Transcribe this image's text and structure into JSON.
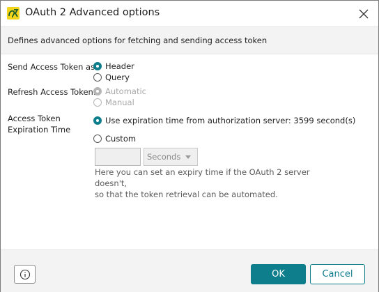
{
  "window": {
    "title": "OAuth 2 Advanced options",
    "icon": "app-logo-icon",
    "close_icon": "close-icon"
  },
  "description": "Defines advanced options for fetching and sending access token",
  "send_token": {
    "label": "Send Access Token as:",
    "options": [
      {
        "label": "Header",
        "checked": true
      },
      {
        "label": "Query",
        "checked": false
      }
    ]
  },
  "refresh_token": {
    "label": "Refresh Access Token:",
    "options": [
      {
        "label": "Automatic",
        "checked": true,
        "disabled": true
      },
      {
        "label": "Manual",
        "checked": false,
        "disabled": true
      }
    ]
  },
  "expiration": {
    "label_line1": "Access Token",
    "label_line2": "Expiration Time",
    "options": [
      {
        "label": "Use expiration time from authorization server: 3599 second(s)",
        "checked": true
      },
      {
        "label": "Custom",
        "checked": false
      }
    ],
    "custom_value": "",
    "unit": "Seconds",
    "hint_line1": "Here you can set an expiry time if the OAuth 2 server doesn't,",
    "hint_line2": "so that the token retrieval can be automated."
  },
  "footer": {
    "info_icon": "info-icon",
    "ok_label": "OK",
    "cancel_label": "Cancel"
  },
  "colors": {
    "accent": "#0e7d8c",
    "band": "#f3f3f3",
    "icon_bg": "#f2d51c"
  }
}
